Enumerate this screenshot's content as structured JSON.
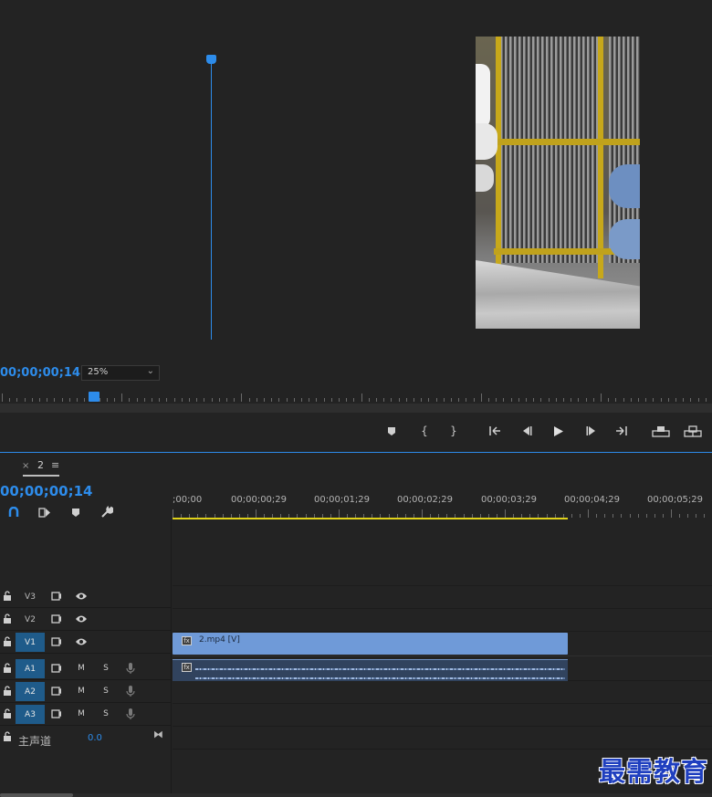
{
  "monitor": {
    "timecode": "00;00;00;14",
    "zoom": "25%",
    "transport": [
      {
        "name": "add-marker-button",
        "icon": "marker-icon"
      },
      {
        "name": "mark-in-button",
        "icon": "mark-in-icon"
      },
      {
        "name": "mark-out-button",
        "icon": "mark-out-icon"
      },
      {
        "name": "go-to-in-button",
        "icon": "go-to-in-icon"
      },
      {
        "name": "step-back-button",
        "icon": "step-back-icon"
      },
      {
        "name": "play-button",
        "icon": "play-icon"
      },
      {
        "name": "step-forward-button",
        "icon": "step-forward-icon"
      },
      {
        "name": "go-to-out-button",
        "icon": "go-to-out-icon"
      },
      {
        "name": "lift-button",
        "icon": "lift-icon"
      },
      {
        "name": "extract-button",
        "icon": "extract-icon"
      }
    ]
  },
  "timeline": {
    "tab": {
      "close": "×",
      "name": "2",
      "menu": "≡"
    },
    "timecode": "00;00;00;14",
    "ruler_labels": [
      ";00;00",
      "00;00;00;29",
      "00;00;01;29",
      "00;00;02;29",
      "00;00;03;29",
      "00;00;04;29",
      "00;00;05;29"
    ],
    "tracks": {
      "video": [
        {
          "name": "V3",
          "active": false
        },
        {
          "name": "V2",
          "active": false
        },
        {
          "name": "V1",
          "active": true
        }
      ],
      "audio": [
        {
          "name": "A1",
          "mute": "M",
          "solo": "S"
        },
        {
          "name": "A2",
          "mute": "M",
          "solo": "S"
        },
        {
          "name": "A3",
          "mute": "M",
          "solo": "S"
        }
      ],
      "master": {
        "label": "主声道",
        "value": "0.0"
      }
    },
    "clips": {
      "video": {
        "label": "2.mp4 [V]",
        "fx": "fx"
      },
      "audio": {
        "fx": "fx"
      }
    }
  },
  "watermark": "最需教育",
  "colors": {
    "accent": "#2d8ceb",
    "video_clip": "#6f9ad8",
    "audio_clip": "#31435e",
    "work_area": "#e0d21a"
  }
}
